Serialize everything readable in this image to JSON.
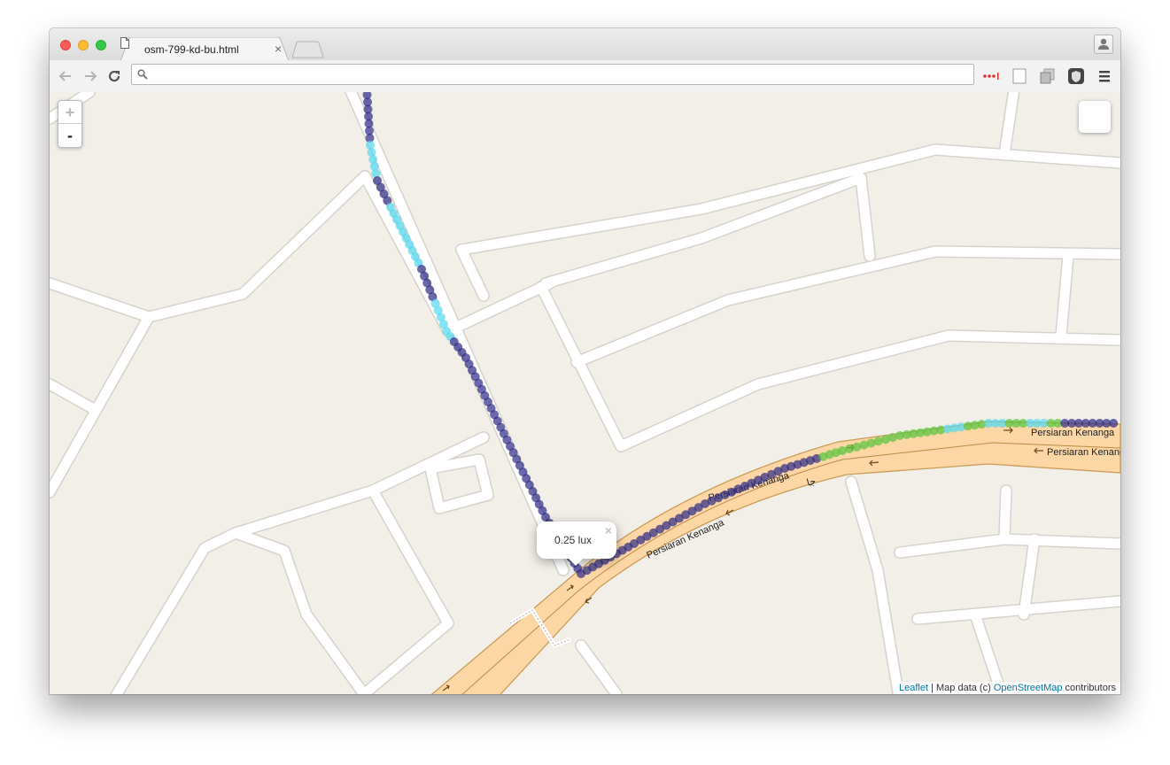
{
  "browser": {
    "tab_title": "osm-799-kd-bu.html",
    "tab_close": "×",
    "url_value": "",
    "url_placeholder": ""
  },
  "map": {
    "zoom_in_label": "+",
    "zoom_out_label": "-",
    "popup_text": "0.25 lux",
    "popup_close": "×",
    "street_names": {
      "label_1": "Persiaran Kenanga",
      "label_2": "Persiaran Kenanga",
      "label_3": "Persiaran Kenanga",
      "label_4": "Persiaran Kenanga",
      "label_5": "ﺟﺎ"
    },
    "attribution": {
      "leaflet": "Leaflet",
      "separator": " | Map data (c) ",
      "osm": "OpenStreetMap",
      "suffix": " contributors"
    },
    "colors": {
      "background": "#f2efe9",
      "minor_road": "#ffffff",
      "major_road": "#fcd6a4",
      "trace_dark": "#2c2a85",
      "trace_cyan": "#52d9f0",
      "trace_green": "#56c43c"
    }
  }
}
